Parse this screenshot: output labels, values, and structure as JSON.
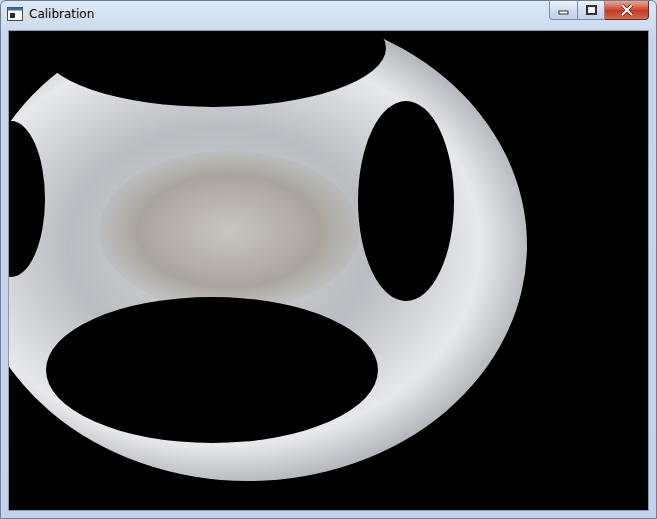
{
  "window": {
    "title": "Calibration"
  }
}
